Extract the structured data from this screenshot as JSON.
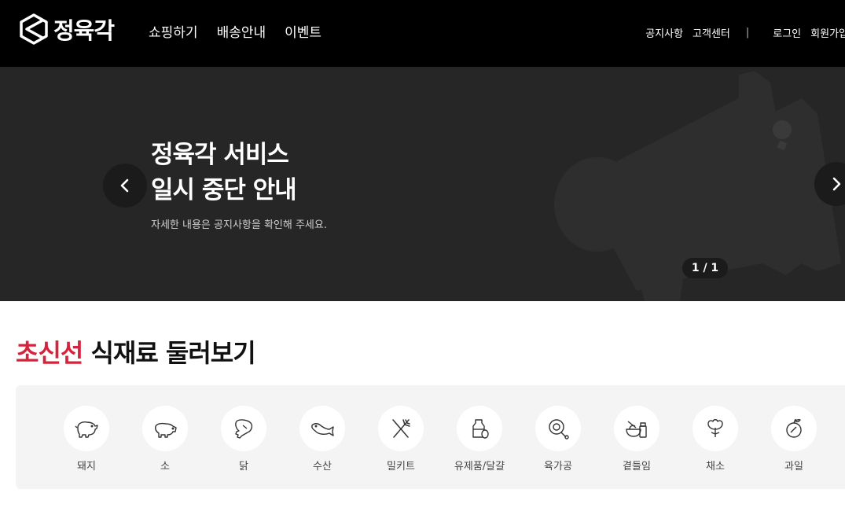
{
  "header": {
    "logo_text": "정육각",
    "nav": [
      "쇼핑하기",
      "배송안내",
      "이벤트"
    ],
    "util": {
      "notice": "공지사항",
      "support": "고객센터",
      "separator": "|",
      "login": "로그인",
      "signup": "회원가입"
    }
  },
  "hero": {
    "title_line1": "정육각 서비스",
    "title_line2": "일시 중단 안내",
    "subtitle": "자세한 내용은 공지사항을 확인해 주세요.",
    "pager": "1 / 1",
    "icons": {
      "prev": "chevron-left-icon",
      "next": "chevron-right-icon",
      "background": "megaphone-icon"
    }
  },
  "section": {
    "title_accent": "초신선",
    "title_rest": " 식재료 둘러보기"
  },
  "categories": [
    {
      "label": "돼지",
      "icon": "pig-icon"
    },
    {
      "label": "소",
      "icon": "cow-icon"
    },
    {
      "label": "닭",
      "icon": "chicken-leg-icon"
    },
    {
      "label": "수산",
      "icon": "fish-icon"
    },
    {
      "label": "밀키트",
      "icon": "fork-knife-icon"
    },
    {
      "label": "유제품/달걀",
      "icon": "milk-egg-icon"
    },
    {
      "label": "육가공",
      "icon": "ham-icon"
    },
    {
      "label": "곁들임",
      "icon": "side-dish-icon"
    },
    {
      "label": "채소",
      "icon": "vegetable-icon"
    },
    {
      "label": "과일",
      "icon": "fruit-icon"
    }
  ],
  "colors": {
    "header_bg": "#000000",
    "hero_bg": "#262626",
    "accent": "#d4243c",
    "category_bg": "#f4f4f4"
  }
}
